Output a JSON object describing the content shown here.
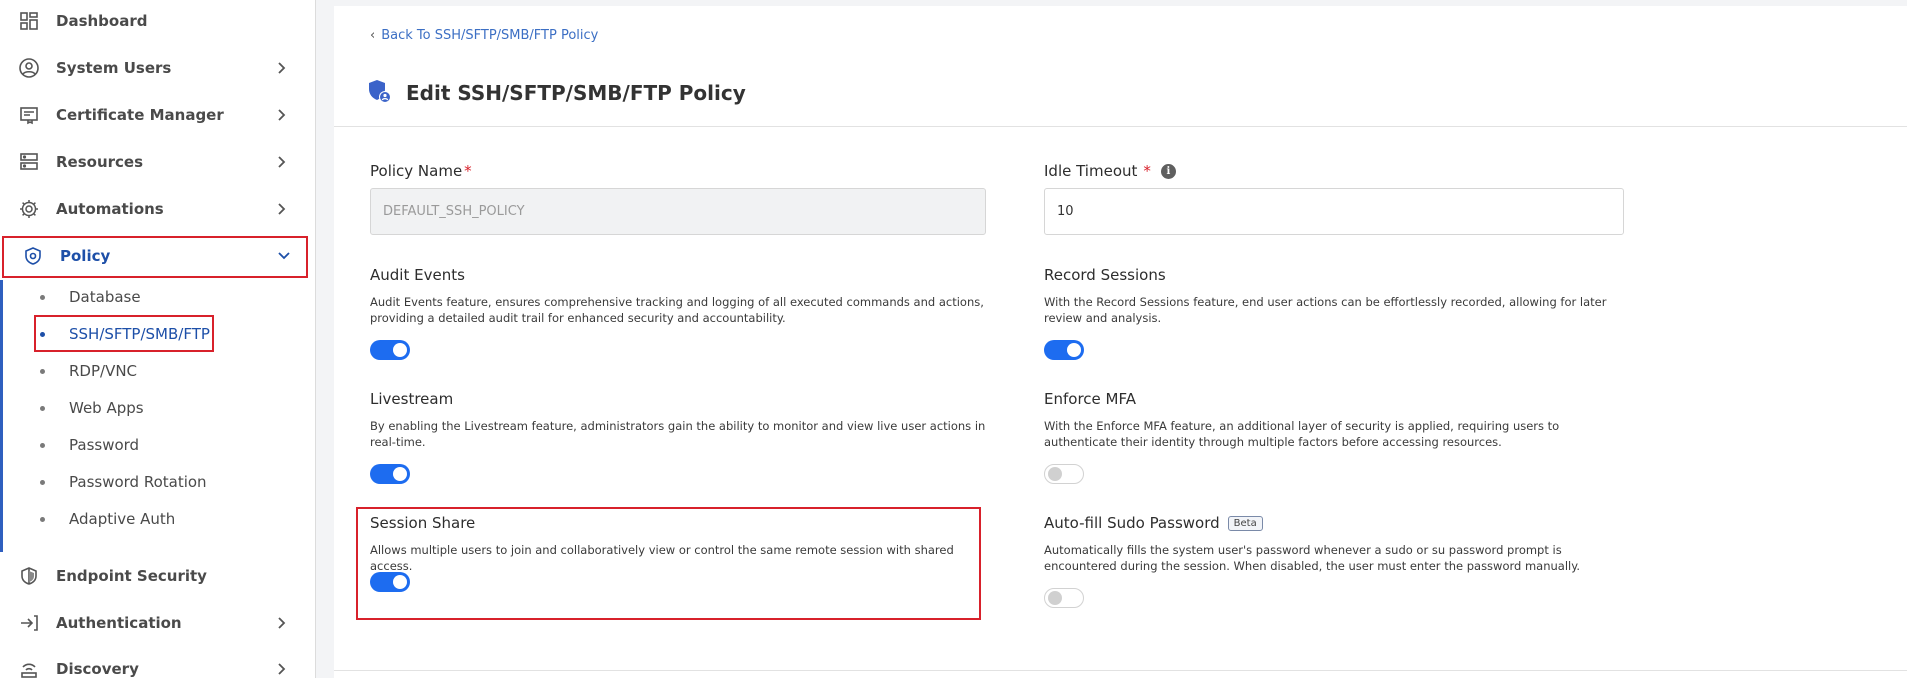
{
  "sidebar": {
    "items": [
      {
        "label": "Dashboard",
        "icon": "dashboard-icon",
        "has_chevron": false
      },
      {
        "label": "System Users",
        "icon": "user-circle-icon",
        "has_chevron": true
      },
      {
        "label": "Certificate Manager",
        "icon": "certificate-icon",
        "has_chevron": true
      },
      {
        "label": "Resources",
        "icon": "server-icon",
        "has_chevron": true
      },
      {
        "label": "Automations",
        "icon": "gear-icon",
        "has_chevron": true
      },
      {
        "label": "Policy",
        "icon": "shield-icon",
        "has_chevron": true,
        "expanded": true
      },
      {
        "label": "Endpoint Security",
        "icon": "shield-half-icon",
        "has_chevron": false
      },
      {
        "label": "Authentication",
        "icon": "login-icon",
        "has_chevron": true
      },
      {
        "label": "Discovery",
        "icon": "radar-icon",
        "has_chevron": true
      }
    ],
    "policy_sub": [
      "Database",
      "SSH/SFTP/SMB/FTP",
      "RDP/VNC",
      "Web Apps",
      "Password",
      "Password Rotation",
      "Adaptive Auth"
    ],
    "active_sub": "SSH/SFTP/SMB/FTP"
  },
  "header": {
    "back_link": "Back To SSH/SFTP/SMB/FTP Policy",
    "title": "Edit SSH/SFTP/SMB/FTP Policy"
  },
  "form": {
    "policy_name": {
      "label": "Policy Name",
      "value": "DEFAULT_SSH_POLICY"
    },
    "idle_timeout": {
      "label": "Idle Timeout",
      "value": "10"
    },
    "audit_events": {
      "title": "Audit Events",
      "desc": "Audit Events feature, ensures comprehensive tracking and logging of all executed commands and actions, providing a detailed audit trail for enhanced security and accountability.",
      "enabled": true
    },
    "record_sessions": {
      "title": "Record Sessions",
      "desc": "With the Record Sessions feature, end user actions can be effortlessly recorded, allowing for later review and analysis.",
      "enabled": true
    },
    "livestream": {
      "title": "Livestream",
      "desc": "By enabling the Livestream feature, administrators gain the ability to monitor and view live user actions in real-time.",
      "enabled": true
    },
    "enforce_mfa": {
      "title": "Enforce MFA",
      "desc": "With the Enforce MFA feature, an additional layer of security is applied, requiring users to authenticate their identity through multiple factors before accessing resources.",
      "enabled": false
    },
    "session_share": {
      "title": "Session Share",
      "desc": "Allows multiple users to join and collaboratively view or control the same remote session with shared access.",
      "enabled": true
    },
    "autofill_sudo": {
      "title": "Auto-fill Sudo Password",
      "badge": "Beta",
      "desc": "Automatically fills the system user's password whenever a sudo or su password prompt is encountered during the session. When disabled, the user must enter the password manually.",
      "enabled": false
    }
  },
  "colors": {
    "accent": "#1d6cf0",
    "active_text": "#1d4fa8",
    "highlight": "#d8212b"
  }
}
